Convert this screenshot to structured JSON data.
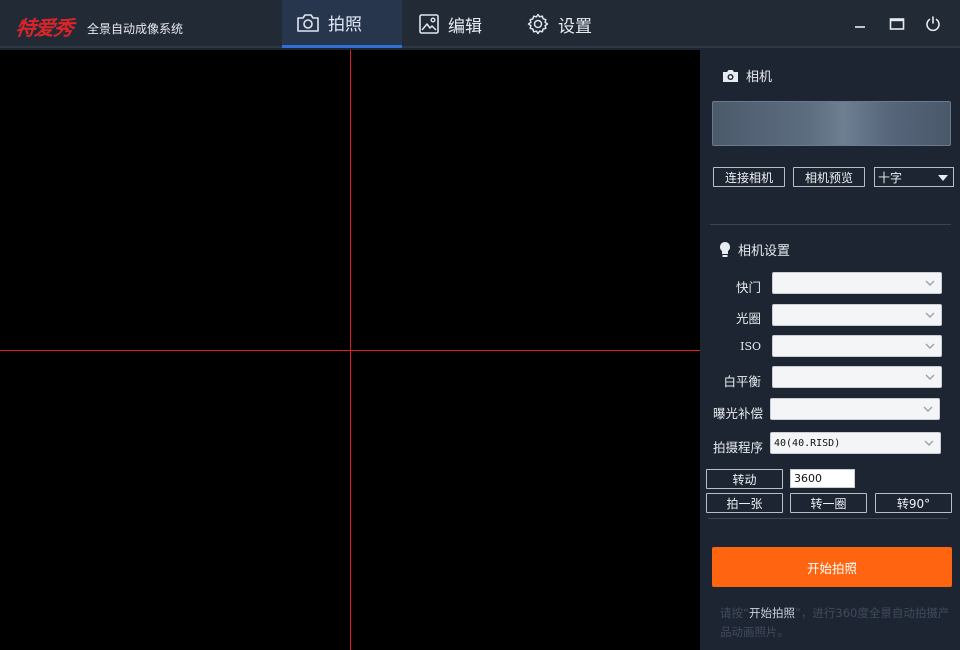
{
  "app": {
    "logo_text": "特爱秀",
    "subtitle": "全景自动成像系统"
  },
  "nav": {
    "tabs": [
      {
        "label": "拍照",
        "icon": "camera-icon",
        "active": true
      },
      {
        "label": "编辑",
        "icon": "image-edit-icon",
        "active": false
      },
      {
        "label": "设置",
        "icon": "gear-icon",
        "active": false
      }
    ]
  },
  "window_controls": [
    "minimize-icon",
    "maximize-icon",
    "power-icon"
  ],
  "viewport": {
    "crosshair_color": "#e01e1e",
    "background": "#000000"
  },
  "camera_section": {
    "title": "相机",
    "connect_label": "连接相机",
    "preview_label": "相机预览",
    "overlay_select_value": "十字"
  },
  "settings_section": {
    "title": "相机设置",
    "shutter_label": "快门",
    "aperture_label": "光圈",
    "iso_label": "ISO",
    "white_balance_label": "白平衡",
    "exposure_label": "曝光补偿",
    "program_label": "拍摄程序",
    "program_value": "40(40.RISD)"
  },
  "rotation": {
    "rotate_label": "转动",
    "rotate_value": "3600",
    "shoot_one_label": "拍一张",
    "turn_circle_label": "转一圈",
    "turn_90_label": "转90°"
  },
  "start": {
    "label": "开始拍照",
    "accent_color": "#ff6510"
  },
  "hint": {
    "prefix": "请按“",
    "highlight": "开始拍照",
    "suffix": "”，进行360度全景自动拍摄产品动画照片。"
  }
}
